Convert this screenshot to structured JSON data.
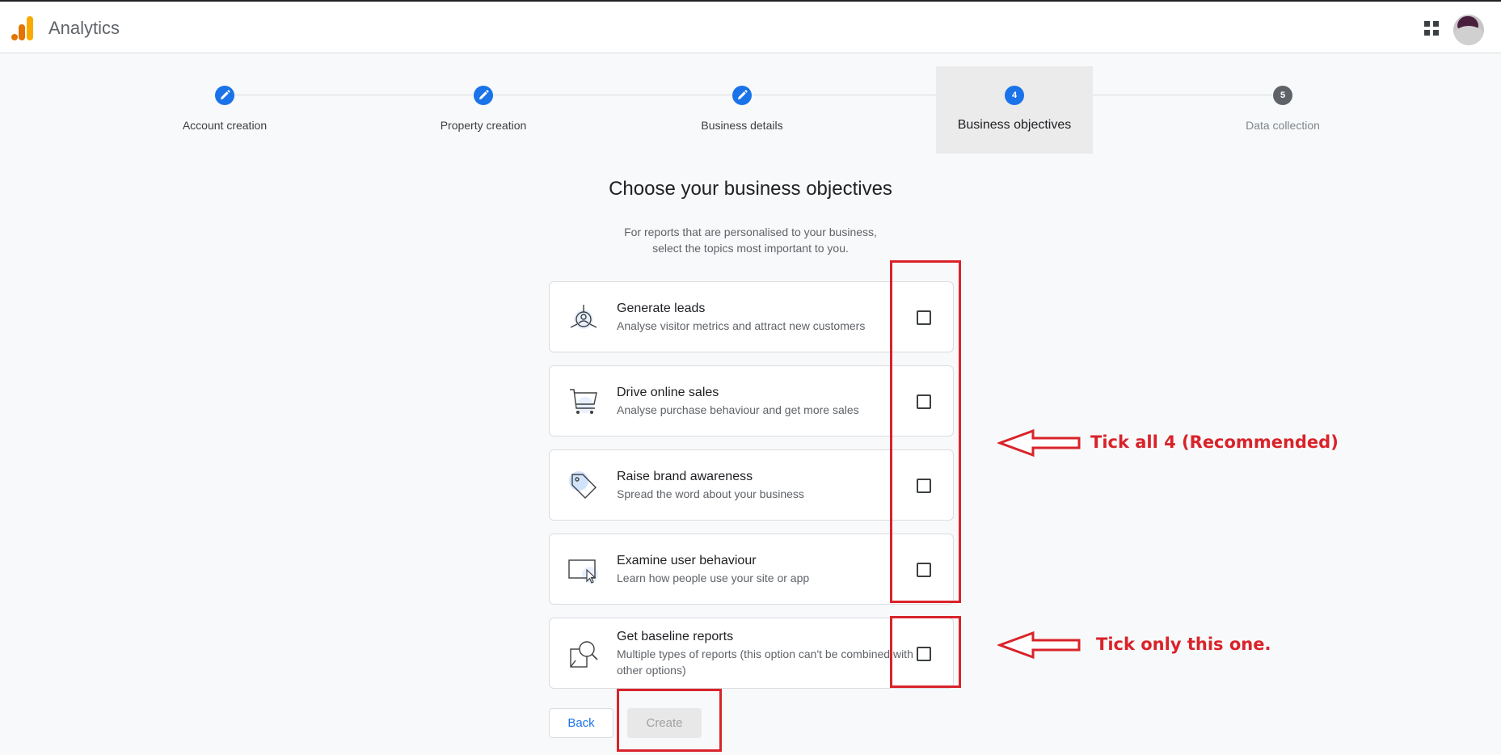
{
  "app": {
    "title": "Analytics"
  },
  "stepper": {
    "steps": [
      {
        "label": "Account creation",
        "state": "done"
      },
      {
        "label": "Property creation",
        "state": "done"
      },
      {
        "label": "Business details",
        "state": "done"
      },
      {
        "label": "Business objectives",
        "number": "4",
        "state": "active"
      },
      {
        "label": "Data collection",
        "number": "5",
        "state": "future"
      }
    ]
  },
  "main": {
    "heading": "Choose your business objectives",
    "subtext_line1": "For reports that are personalised to your business,",
    "subtext_line2": "select the topics most important to you.",
    "objectives": [
      {
        "title": "Generate leads",
        "description": "Analyse visitor metrics and attract new customers",
        "icon": "leads-icon",
        "checked": false
      },
      {
        "title": "Drive online sales",
        "description": "Analyse purchase behaviour and get more sales",
        "icon": "shopping-cart-icon",
        "checked": false
      },
      {
        "title": "Raise brand awareness",
        "description": "Spread the word about your business",
        "icon": "tag-icon",
        "checked": false
      },
      {
        "title": "Examine user behaviour",
        "description": "Learn how people use your site or app",
        "icon": "screen-cursor-icon",
        "checked": false
      },
      {
        "title": "Get baseline reports",
        "description": "Multiple types of reports (this option can't be combined with other options)",
        "icon": "report-magnifier-icon",
        "checked": false
      }
    ],
    "back_label": "Back",
    "create_label": "Create"
  },
  "annotations": {
    "tick_all": "Tick all 4 (Recommended)",
    "tick_one": "Tick only this one.",
    "color": "#d9232a"
  },
  "colors": {
    "accent": "#1a73e8",
    "annotation": "#d9232a"
  }
}
